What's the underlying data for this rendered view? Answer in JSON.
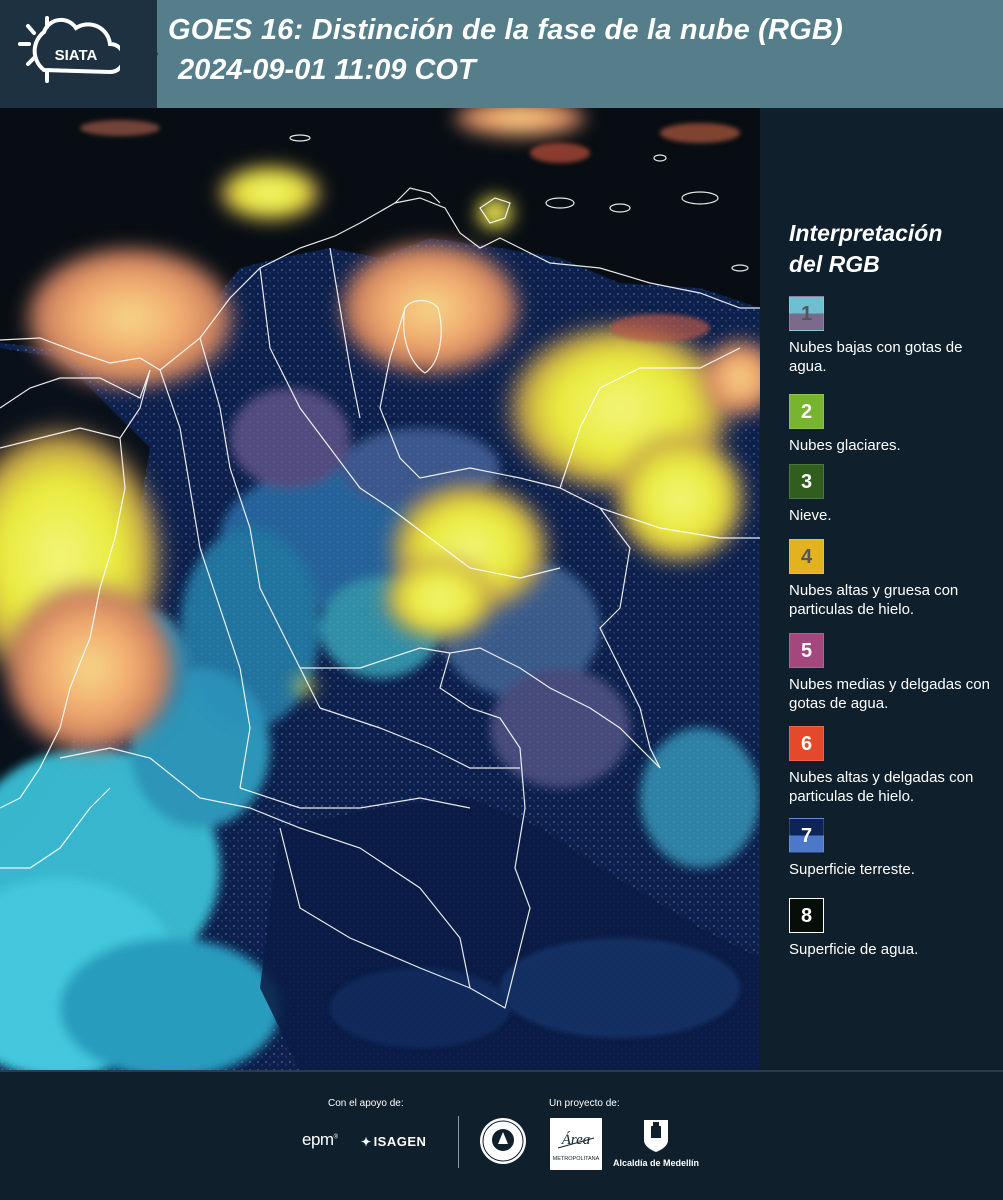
{
  "header": {
    "logo_text": "SIATA",
    "title": "GOES 16: Distinción de la fase de la nube (RGB)",
    "subtitle": "2024-09-01 11:09 COT"
  },
  "legend": {
    "title_line1": "Interpretación",
    "title_line2": "del RGB",
    "items": [
      {
        "number": "1",
        "label": "Nubes bajas con gotas de agua.",
        "color_top": "#6fbfd0",
        "color_bottom": "#7a6b8d"
      },
      {
        "number": "2",
        "label": "Nubes glaciares.",
        "color_top": "#77b42f",
        "color_bottom": "#77b42f"
      },
      {
        "number": "3",
        "label": "Nieve.",
        "color_top": "#2f5e1e",
        "color_bottom": "#2f5e1e"
      },
      {
        "number": "4",
        "label": "Nubes altas y gruesa con particulas de hielo.",
        "color_top": "#e2b31f",
        "color_bottom": "#e2b31f"
      },
      {
        "number": "5",
        "label": "Nubes medias y delgadas con gotas de agua.",
        "color_top": "#a4477d",
        "color_bottom": "#a4477d"
      },
      {
        "number": "6",
        "label": "Nubes altas y delgadas con particulas de hielo.",
        "color_top": "#e5492c",
        "color_bottom": "#e5492c"
      },
      {
        "number": "7",
        "label": "Superficie terreste.",
        "color_top": "#0e2358",
        "color_bottom": "#4b78c8"
      },
      {
        "number": "8",
        "label": "Superficie de agua.",
        "color_top": "#070d09",
        "color_bottom": "#070d09"
      }
    ]
  },
  "footer": {
    "support_label": "Con el apoyo de:",
    "project_label": "Un proyecto de:",
    "epm": "epm",
    "isagen": "ISAGEN",
    "area_text": "Área",
    "area_sub": "METROPOLITANA",
    "alcaldia": "Alcaldía de Medellín"
  }
}
